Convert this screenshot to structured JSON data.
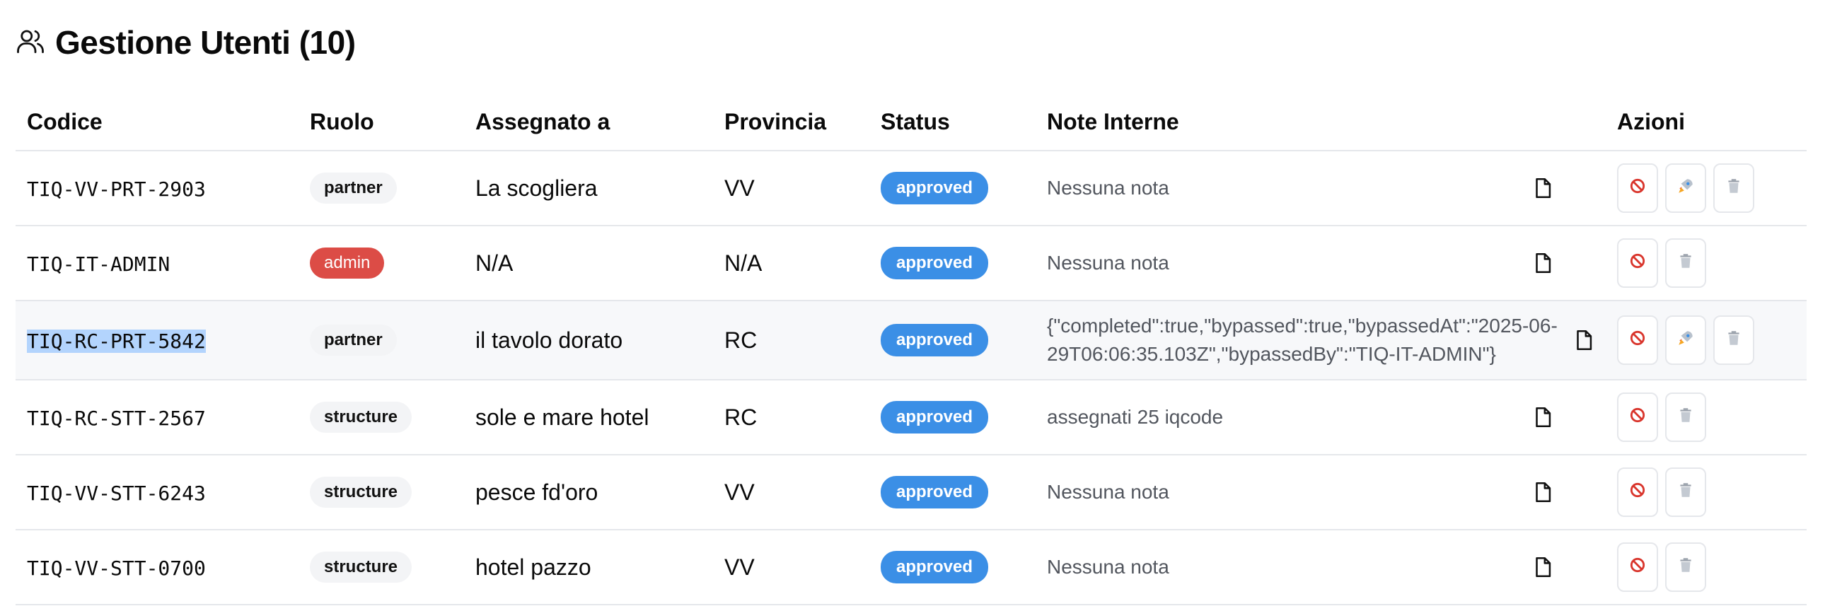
{
  "header": {
    "title": "Gestione Utenti (10)",
    "icon": "users-icon"
  },
  "table": {
    "columns": [
      "Codice",
      "Ruolo",
      "Assegnato a",
      "Provincia",
      "Status",
      "Note Interne",
      "Azioni"
    ],
    "rows": [
      {
        "code": "TIQ-VV-PRT-2903",
        "role": "partner",
        "assigned": "La scogliera",
        "province": "VV",
        "status": "approved",
        "note": "Nessuna nota",
        "actions": [
          "ban",
          "rocket",
          "trash"
        ]
      },
      {
        "code": "TIQ-IT-ADMIN",
        "role": "admin",
        "assigned": "N/A",
        "province": "N/A",
        "status": "approved",
        "note": "Nessuna nota",
        "actions": [
          "ban",
          "trash"
        ]
      },
      {
        "code": "TIQ-RC-PRT-5842",
        "role": "partner",
        "assigned": "il tavolo dorato",
        "province": "RC",
        "status": "approved",
        "note": "{\"completed\":true,\"bypassed\":true,\"bypassedAt\":\"2025-06-29T06:06:35.103Z\",\"bypassedBy\":\"TIQ-IT-ADMIN\"}",
        "actions": [
          "ban",
          "rocket",
          "trash"
        ],
        "selected": true
      },
      {
        "code": "TIQ-RC-STT-2567",
        "role": "structure",
        "assigned": "sole e mare hotel",
        "province": "RC",
        "status": "approved",
        "note": "assegnati 25 iqcode",
        "actions": [
          "ban",
          "trash"
        ]
      },
      {
        "code": "TIQ-VV-STT-6243",
        "role": "structure",
        "assigned": "pesce fd'oro",
        "province": "VV",
        "status": "approved",
        "note": "Nessuna nota",
        "actions": [
          "ban",
          "trash"
        ]
      },
      {
        "code": "TIQ-VV-STT-0700",
        "role": "structure",
        "assigned": "hotel pazzo",
        "province": "VV",
        "status": "approved",
        "note": "Nessuna nota",
        "actions": [
          "ban",
          "trash"
        ]
      }
    ]
  },
  "colors": {
    "status_bg": "#3b8fe6",
    "admin_bg": "#dc4c46",
    "ban_icon": "#d9352c",
    "selection": "#b3d4fd"
  }
}
